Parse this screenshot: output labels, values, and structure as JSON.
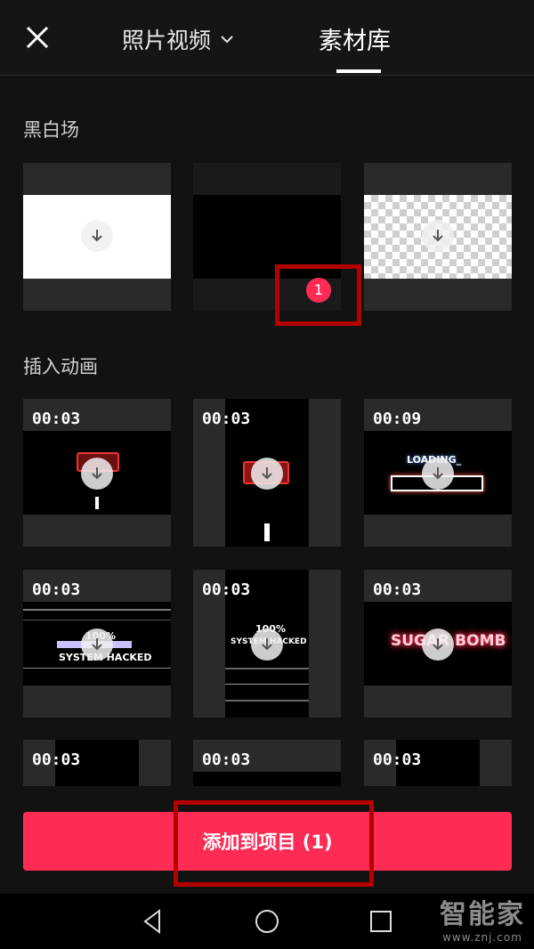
{
  "header": {
    "tab_photos": "照片视频",
    "tab_library": "素材库"
  },
  "sections": {
    "bw_title": "黑白场",
    "anim_title": "插入动画"
  },
  "badge": "1",
  "tiles": {
    "a1": "00:03",
    "a2": "00:03",
    "a3": "00:09",
    "b1": "00:03",
    "b2": "00:03",
    "b3": "00:03",
    "c1": "00:03",
    "c2": "00:03",
    "c3": "00:03"
  },
  "thumb_text": {
    "loading": "LOADING_",
    "sys1_pct": "100%",
    "sys1": "SYSTEM HACKED",
    "sys2_pct": "100%",
    "sys2": "SYSTEM HACKED",
    "sugar": "SUGAR BOMB"
  },
  "add_button": "添加到项目 (1)",
  "watermark": {
    "big": "智能家",
    "small": "www.znj.com"
  },
  "colors": {
    "accent": "#fe2c55",
    "highlight_box": "#b50000",
    "background": "#121212"
  },
  "icons": [
    "close-icon",
    "chevron-down-icon",
    "download-icon",
    "back-icon",
    "home-icon",
    "recents-icon"
  ]
}
